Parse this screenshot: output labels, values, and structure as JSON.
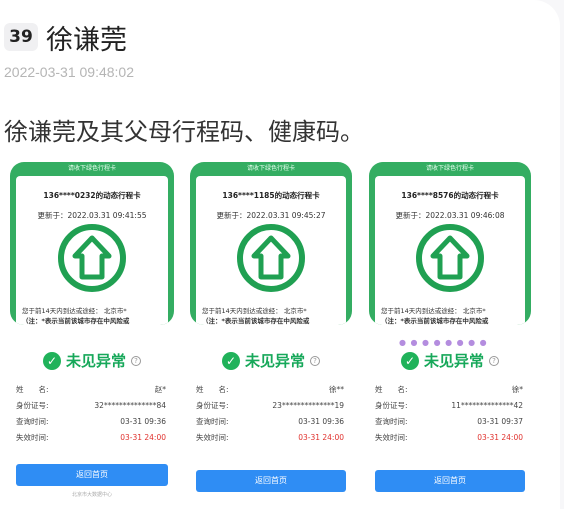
{
  "post": {
    "rank": "39",
    "author": "徐谦莞",
    "timestamp": "2022-03-31 09:48:02",
    "text": "徐谦莞及其父母行程码、健康码。"
  },
  "trip_cards": [
    {
      "header": "请收下绿色行程卡",
      "phone_line": "136****0232的动态行程卡",
      "updated": "更新于：2022.03.31 09:41:55",
      "route": "您于前14天内到达或途经： 北京市*",
      "note": "（注：*表示当前该城市存在中风险或"
    },
    {
      "header": "请收下绿色行程卡",
      "phone_line": "136****1185的动态行程卡",
      "updated": "更新于：2022.03.31 09:45:27",
      "route": "您于前14天内到达或途经： 北京市*",
      "note": "（注：*表示当前该城市存在中风险或"
    },
    {
      "header": "请收下绿色行程卡",
      "phone_line": "136****8576的动态行程卡",
      "updated": "更新于：2022.03.31 09:46:08",
      "route": "您于前14天内到达或途经： 北京市*",
      "note": "（注：*表示当前该城市存在中风险或"
    }
  ],
  "health_cards": [
    {
      "status": "未见异常",
      "name_label": "姓　　名:",
      "name_value": "赵*",
      "id_label": "身份证号:",
      "id_value": "32**************84",
      "query_label": "查询时间:",
      "query_value": "03-31 09:36",
      "expire_label": "失效时间:",
      "expire_value": "03-31 24:00",
      "button": "返回首页",
      "footer": "北京市大数据中心"
    },
    {
      "status": "未见异常",
      "name_label": "姓　　名:",
      "name_value": "徐**",
      "id_label": "身份证号:",
      "id_value": "23**************19",
      "query_label": "查询时间:",
      "query_value": "03-31 09:36",
      "expire_label": "失效时间:",
      "expire_value": "03-31 24:00",
      "button": "返回首页",
      "footer": ""
    },
    {
      "status": "未见异常",
      "name_label": "姓　　名:",
      "name_value": "徐*",
      "id_label": "身份证号:",
      "id_value": "11**************42",
      "query_label": "查询时间:",
      "query_value": "03-31 09:37",
      "expire_label": "失效时间:",
      "expire_value": "03-31 24:00",
      "button": "返回首页",
      "footer": ""
    }
  ],
  "colors": {
    "trip_green": "#34ad62",
    "status_green": "#17a85a",
    "expire_red": "#e0322e",
    "button_blue": "#2f8df4"
  },
  "icons": {
    "arrow": "up-arrow-circle-icon",
    "check": "check-circle-icon",
    "help": "question-circle-icon"
  }
}
